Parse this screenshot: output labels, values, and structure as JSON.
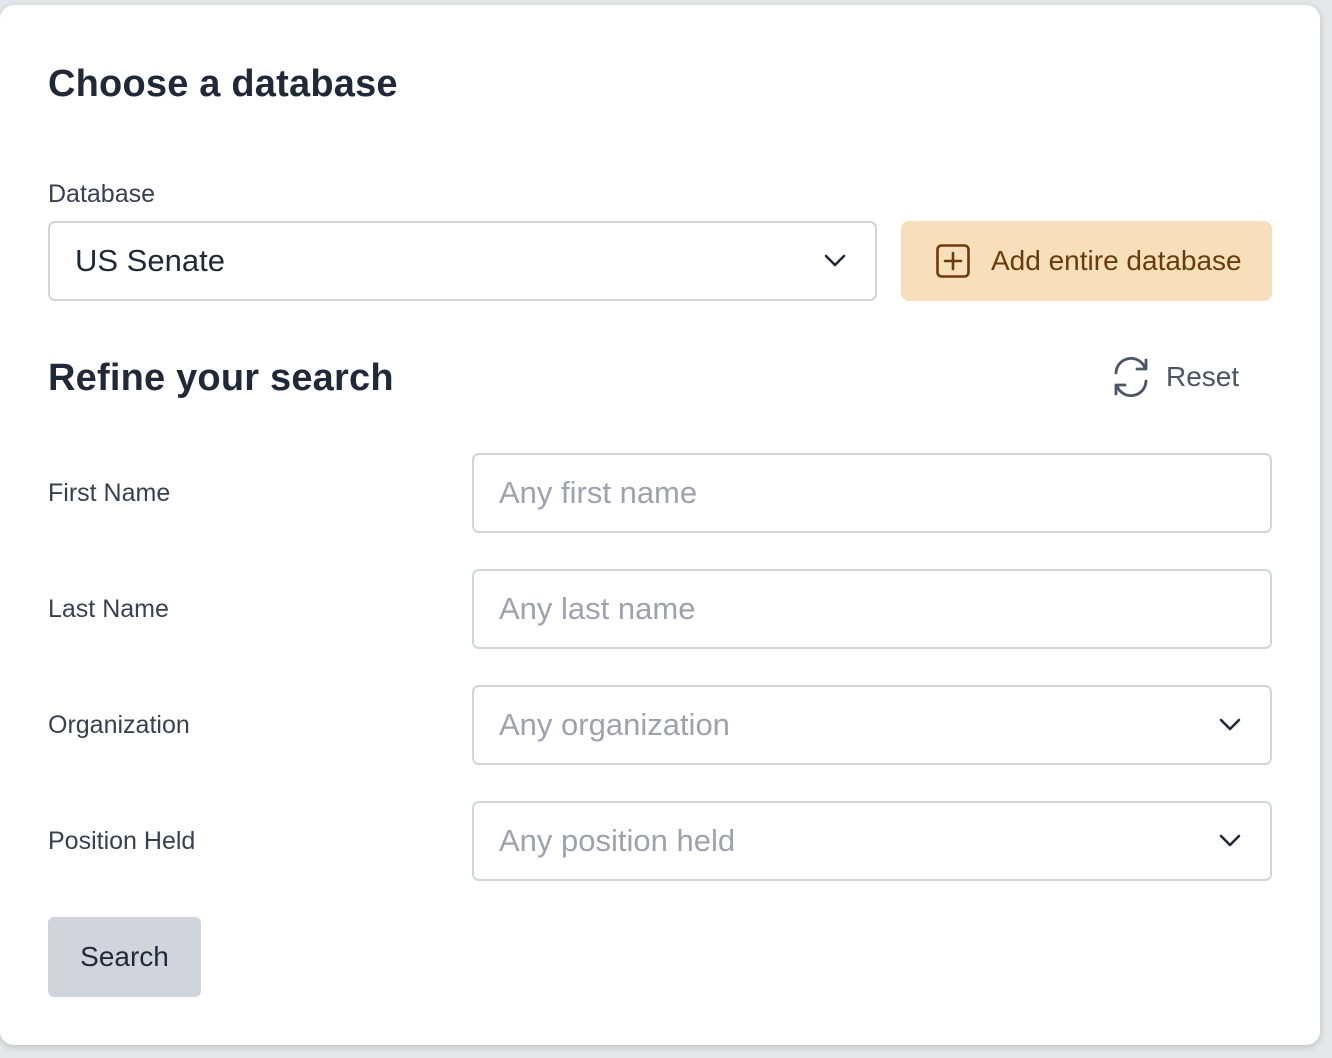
{
  "database_section": {
    "title": "Choose a database",
    "database_label": "Database",
    "database_value": "US Senate",
    "add_button_label": "Add entire database"
  },
  "refine_section": {
    "title": "Refine your search",
    "reset_label": "Reset",
    "fields": {
      "first_name": {
        "label": "First Name",
        "placeholder": "Any first name"
      },
      "last_name": {
        "label": "Last Name",
        "placeholder": "Any last name"
      },
      "organization": {
        "label": "Organization",
        "placeholder": "Any organization"
      },
      "position_held": {
        "label": "Position Held",
        "placeholder": "Any position held"
      }
    },
    "search_button_label": "Search"
  },
  "icons": {
    "add": "plus-square-icon",
    "reset": "refresh-icon",
    "dropdown": "chevron-down-icon"
  },
  "colors": {
    "add_button_bg": "#f8dfbb",
    "add_button_text": "#6b3a0c",
    "search_button_bg": "#d1d5db",
    "placeholder": "#9ca3af"
  }
}
